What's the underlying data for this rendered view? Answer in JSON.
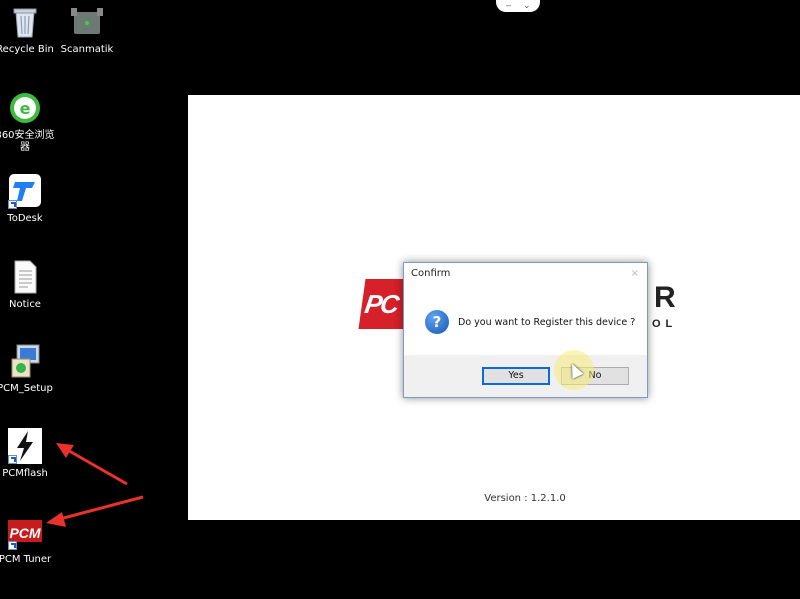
{
  "desktop": {
    "icons": [
      {
        "label": "Recycle Bin"
      },
      {
        "label": "Scanmatik"
      },
      {
        "label": "360安全浏览器"
      },
      {
        "label": "ToDesk"
      },
      {
        "label": "Notice"
      },
      {
        "label": "PCM_Setup"
      },
      {
        "label": "PCMflash"
      },
      {
        "label": "PCM Tuner"
      }
    ]
  },
  "top_handle": {
    "left_glyph": "–",
    "right_glyph": "⌄"
  },
  "app": {
    "logo_left_text": "PC",
    "logo_right_text": "R",
    "logo_right_sub": "OL",
    "version": "Version : 1.2.1.0"
  },
  "dialog": {
    "title": "Confirm",
    "close_glyph": "×",
    "message": "Do you want to Register this device ?",
    "yes_label": "Yes",
    "no_label": "No"
  },
  "colors": {
    "brand_red": "#d6202a",
    "focus_blue": "#0d6bd8",
    "arrow_red": "#e8322b"
  }
}
